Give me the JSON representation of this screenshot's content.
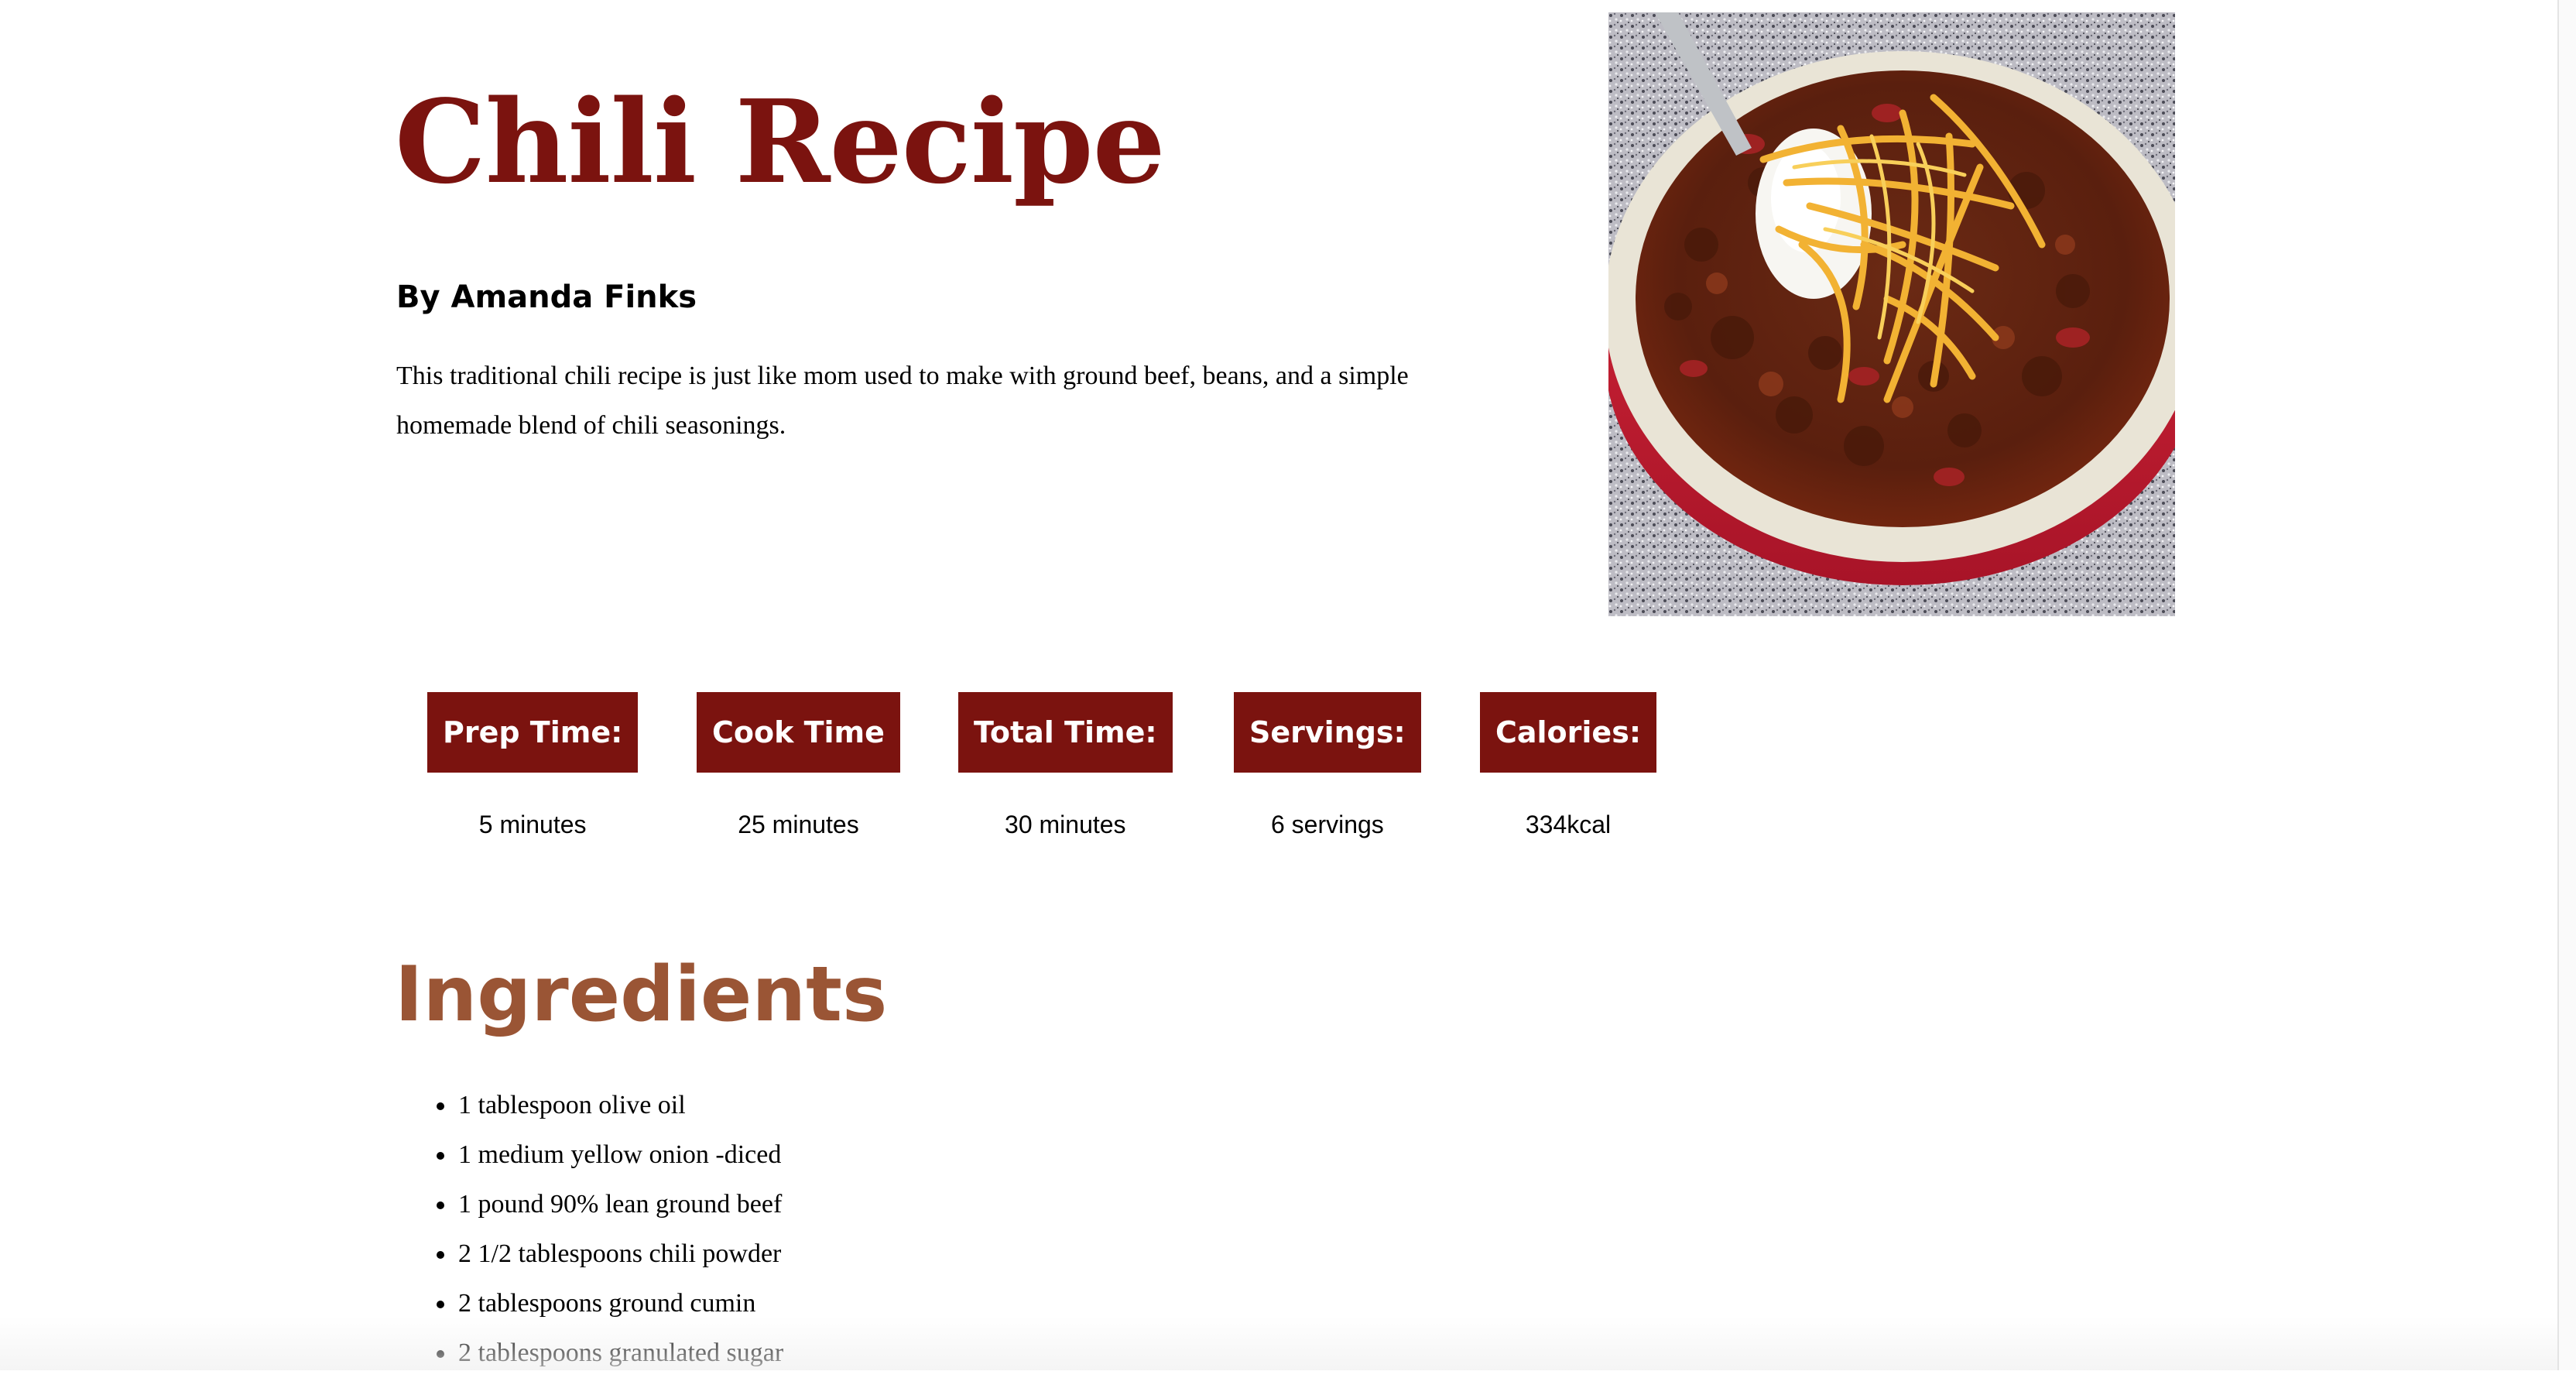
{
  "header": {
    "title": "Chili Recipe",
    "author": "By Amanda Finks",
    "description": "This traditional chili recipe is just like mom used to make with ground beef, beans, and a simple homemade blend of chili seasonings."
  },
  "hero_image": {
    "icon": "chili-bowl-photo"
  },
  "stats": [
    {
      "label": "Prep Time:",
      "value": "5 minutes"
    },
    {
      "label": "Cook Time",
      "value": "25 minutes"
    },
    {
      "label": "Total Time:",
      "value": "30 minutes"
    },
    {
      "label": "Servings:",
      "value": "6 servings"
    },
    {
      "label": "Calories:",
      "value": "334kcal"
    }
  ],
  "ingredients": {
    "title": "Ingredients",
    "items": [
      "1 tablespoon olive oil",
      "1 medium yellow onion -diced",
      "1 pound 90% lean ground beef",
      "2 1/2 tablespoons chili powder",
      "2 tablespoons ground cumin",
      "2 tablespoons granulated sugar"
    ]
  },
  "colors": {
    "accent": "#7b130f",
    "section_title": "#9a5535"
  }
}
